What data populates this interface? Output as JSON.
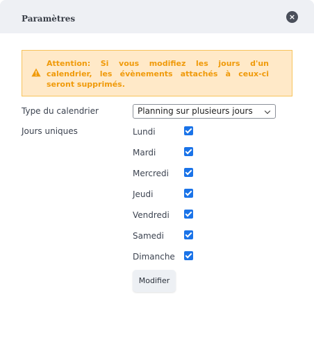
{
  "dialog": {
    "title": "Paramètres",
    "close_label": "×"
  },
  "alert": {
    "text": "Attention: Si vous modifiez les jours d'un calendrier, les évènements attachés à ceux-ci seront supprimés.",
    "icon": "warning-icon",
    "color": "#f09a0a",
    "background": "#ffe9c8"
  },
  "form": {
    "calendar_type_label": "Type du calendrier",
    "calendar_type_value": "Planning sur plusieurs jours",
    "unique_days_label": "Jours uniques",
    "days": [
      {
        "label": "Lundi",
        "checked": true
      },
      {
        "label": "Mardi",
        "checked": true
      },
      {
        "label": "Mercredi",
        "checked": true
      },
      {
        "label": "Jeudi",
        "checked": true
      },
      {
        "label": "Vendredi",
        "checked": true
      },
      {
        "label": "Samedi",
        "checked": true
      },
      {
        "label": "Dimanche",
        "checked": true
      }
    ],
    "submit_label": "Modifier"
  },
  "colors": {
    "checkbox": "#1a73e8",
    "header": "#eef0f4"
  }
}
